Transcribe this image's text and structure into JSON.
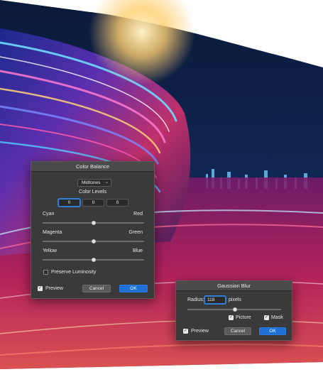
{
  "colors": {
    "accent": "#1f6fd6",
    "dialog_bg": "#3a3a3a",
    "dialog_title_bg": "#4a4a4a",
    "text": "#e6e6e6"
  },
  "color_balance": {
    "title": "Color Balance",
    "tone_dropdown": {
      "selected": "Midtones",
      "icon": "chevron-down-icon"
    },
    "levels_label": "Color Levels",
    "levels": [
      "0",
      "0",
      "0"
    ],
    "sliders": [
      {
        "left_label": "Cyan",
        "right_label": "Red",
        "value": 0,
        "min": -100,
        "max": 100
      },
      {
        "left_label": "Magenta",
        "right_label": "Green",
        "value": 0,
        "min": -100,
        "max": 100
      },
      {
        "left_label": "Yellow",
        "right_label": "Blue",
        "value": 0,
        "min": -100,
        "max": 100
      }
    ],
    "preserve_luminosity": {
      "label": "Preserve Luminosity",
      "checked": false
    },
    "preview": {
      "label": "Preview",
      "checked": true
    },
    "cancel_label": "Cancel",
    "ok_label": "OK"
  },
  "gaussian_blur": {
    "title": "Gaussian Blur",
    "radius_label": "Radius:",
    "radius_value": "118",
    "radius_unit": "pixels",
    "radius_slider_fraction": 0.51,
    "picture": {
      "label": "Picture",
      "checked": true
    },
    "mask": {
      "label": "Mask",
      "checked": true
    },
    "preview": {
      "label": "Preview",
      "checked": true
    },
    "cancel_label": "Cancel",
    "ok_label": "OK"
  }
}
